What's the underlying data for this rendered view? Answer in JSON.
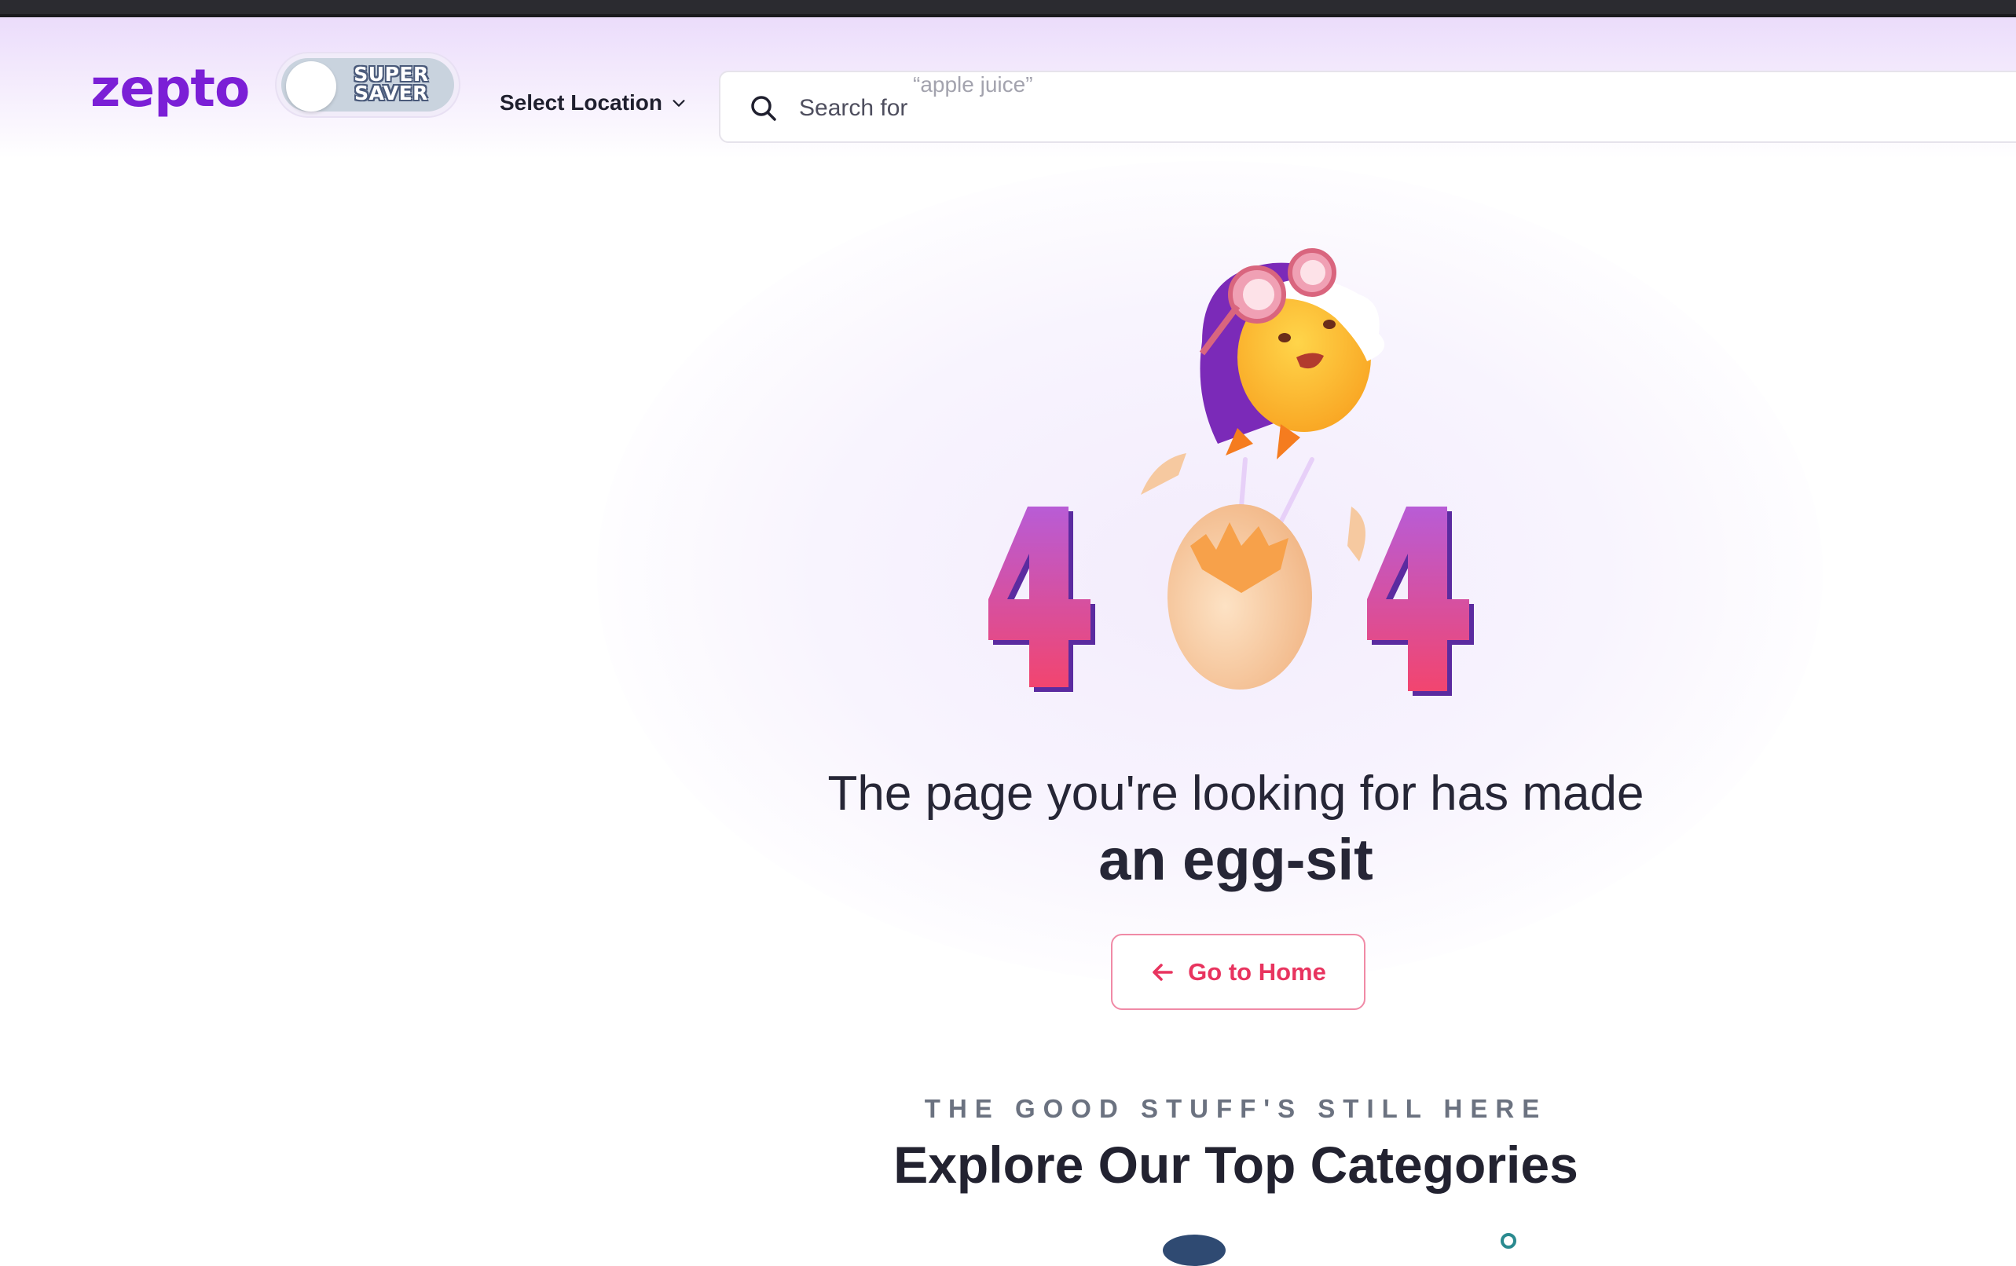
{
  "header": {
    "logo": "zepto",
    "super_saver": {
      "line1": "SUPER",
      "line2": "SAVER",
      "enabled": false
    },
    "location_label": "Select Location",
    "search": {
      "label": "Search for",
      "hint": "“apple juice”"
    }
  },
  "hero": {
    "error_code": "404",
    "headline": "The page you're looking for has made",
    "headline_bold": "an egg-sit",
    "home_button": "Go to Home"
  },
  "categories": {
    "eyebrow": "THE GOOD STUFF'S STILL HERE",
    "title": "Explore Our Top Categories"
  },
  "colors": {
    "brand": "#7b1fd6",
    "accent": "#e8345f",
    "digit_gradient_top": "#b85cd6",
    "digit_gradient_bottom": "#f2456f"
  },
  "icons": {
    "search": "search-icon",
    "location": "chevron-down-icon",
    "home": "arrow-left-icon"
  }
}
